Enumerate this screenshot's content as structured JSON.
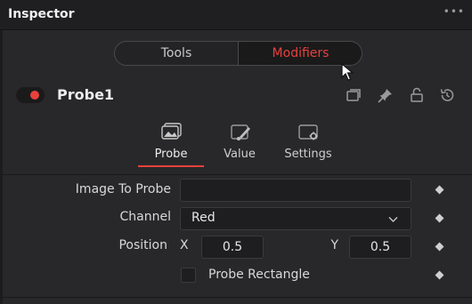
{
  "header": {
    "title": "Inspector",
    "menu_icon": "more-dots-icon",
    "menu_glyph": "•••"
  },
  "mode_tabs": [
    {
      "label": "Tools",
      "active": false
    },
    {
      "label": "Modifiers",
      "active": true
    }
  ],
  "tool": {
    "name": "Probe1",
    "enabled": true,
    "icons": [
      "versions-icon",
      "pin-icon",
      "lock-icon",
      "reset-icon"
    ]
  },
  "sub_tabs": [
    {
      "label": "Probe",
      "icon": "probe-image-icon",
      "active": true
    },
    {
      "label": "Value",
      "icon": "value-brush-icon",
      "active": false
    },
    {
      "label": "Settings",
      "icon": "settings-gear-icon",
      "active": false
    }
  ],
  "params": {
    "image_to_probe": {
      "label": "Image To Probe",
      "value": ""
    },
    "channel": {
      "label": "Channel",
      "value": "Red"
    },
    "position": {
      "label": "Position",
      "x_label": "X",
      "x_value": "0.5",
      "y_label": "Y",
      "y_value": "0.5"
    },
    "probe_rectangle": {
      "label": "Probe Rectangle",
      "checked": false
    }
  },
  "colors": {
    "accent": "#e8413c",
    "background": "#28282a",
    "header": "#1f1f21",
    "field": "#1e1e20"
  }
}
